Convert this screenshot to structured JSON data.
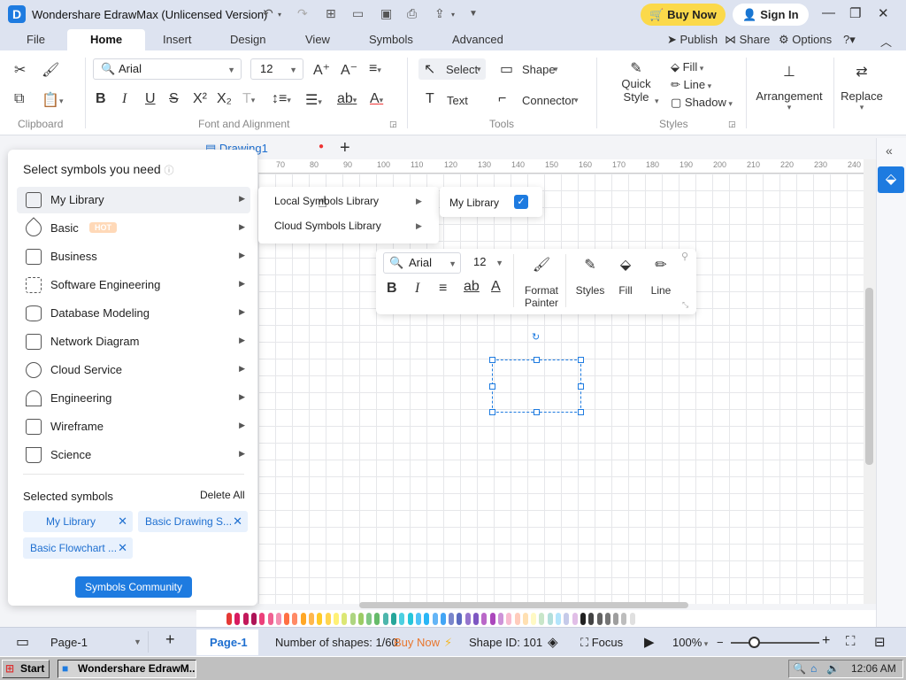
{
  "window": {
    "title": "Wondershare EdrawMax (Unlicensed Version)",
    "buy_now": "Buy Now",
    "sign_in": "Sign In"
  },
  "menu": {
    "tabs": [
      "File",
      "Home",
      "Insert",
      "Design",
      "View",
      "Symbols",
      "Advanced"
    ],
    "active": "Home",
    "publish": "Publish",
    "share": "Share",
    "options": "Options"
  },
  "ribbon": {
    "font_family": "Arial",
    "font_size": "12",
    "select": "Select",
    "shape": "Shape",
    "text": "Text",
    "connector": "Connector",
    "quick_style_1": "Quick",
    "quick_style_2": "Style",
    "fill": "Fill",
    "line": "Line",
    "shadow": "Shadow",
    "arrangement": "Arrangement",
    "replace": "Replace",
    "groups": {
      "clipboard": "Clipboard",
      "font_alignment": "Font and Alignment",
      "tools": "Tools",
      "styles": "Styles"
    }
  },
  "document": {
    "tab_name": "Drawing1",
    "ruler_ticks": [
      "70",
      "80",
      "90",
      "100",
      "110",
      "120",
      "130",
      "140",
      "150",
      "160",
      "170",
      "180",
      "190",
      "200",
      "210",
      "220",
      "230",
      "240"
    ]
  },
  "symbol_panel": {
    "title": "Select symbols you need",
    "categories": [
      {
        "label": "My Library"
      },
      {
        "label": "Basic",
        "badge": "HOT"
      },
      {
        "label": "Business"
      },
      {
        "label": "Software Engineering"
      },
      {
        "label": "Database Modeling"
      },
      {
        "label": "Network Diagram"
      },
      {
        "label": "Cloud Service"
      },
      {
        "label": "Engineering"
      },
      {
        "label": "Wireframe"
      },
      {
        "label": "Science"
      }
    ],
    "selected_title": "Selected symbols",
    "delete_all": "Delete All",
    "selected": [
      "My Library",
      "Basic Drawing S...",
      "Basic Flowchart ..."
    ],
    "community_button": "Symbols Community"
  },
  "submenu": {
    "local": "Local Symbols Library",
    "cloud": "Cloud Symbols Library",
    "my_library": "My Library"
  },
  "float_toolbar": {
    "font": "Arial",
    "size": "12",
    "format_painter_1": "Format",
    "format_painter_2": "Painter",
    "styles": "Styles",
    "fill": "Fill",
    "line": "Line"
  },
  "status": {
    "page_selector": "Page-1",
    "active_page": "Page-1",
    "shapes": "Number of shapes: 1/60",
    "buy_now": "Buy Now",
    "shape_id": "Shape ID: 101",
    "focus": "Focus",
    "zoom": "100%"
  },
  "taskbar": {
    "start": "Start",
    "app": "Wondershare EdrawM...",
    "time": "12:06 AM"
  },
  "palette_colors": [
    "#e53935",
    "#d81b60",
    "#c2185b",
    "#ad1457",
    "#ec407a",
    "#f06292",
    "#f48fb1",
    "#ff7043",
    "#ff8a65",
    "#ffa726",
    "#ffb74d",
    "#ffca28",
    "#ffd54f",
    "#fff176",
    "#dce775",
    "#aed581",
    "#9ccc65",
    "#81c784",
    "#66bb6a",
    "#4db6ac",
    "#26a69a",
    "#4dd0e1",
    "#26c6da",
    "#4fc3f7",
    "#29b6f6",
    "#64b5f6",
    "#42a5f5",
    "#7986cb",
    "#5c6bc0",
    "#9575cd",
    "#7e57c2",
    "#ba68c8",
    "#ab47bc",
    "#ce93d8",
    "#f8bbd0",
    "#ffccbc",
    "#ffe0b2",
    "#fff9c4",
    "#c8e6c9",
    "#b2dfdb",
    "#b3e5fc",
    "#c5cae9",
    "#e1bee7",
    "#212121",
    "#424242",
    "#616161",
    "#757575",
    "#9e9e9e",
    "#bdbdbd",
    "#e0e0e0"
  ]
}
